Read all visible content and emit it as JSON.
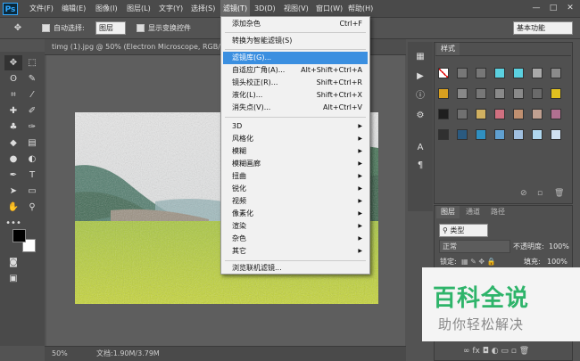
{
  "app": {
    "logo": "Ps"
  },
  "menubar": {
    "items": [
      "文件(F)",
      "编辑(E)",
      "图像(I)",
      "图层(L)",
      "文字(Y)",
      "选择(S)",
      "滤镜(T)",
      "3D(D)",
      "视图(V)",
      "窗口(W)",
      "帮助(H)"
    ],
    "active": "滤镜(T)"
  },
  "window_controls": {
    "minimize": "—",
    "restore": "□",
    "close": "✕"
  },
  "options_bar": {
    "auto_select_label": "自动选择:",
    "auto_select_value": "图层",
    "show_transform_label": "显示变换控件",
    "workspace_value": "基本功能"
  },
  "document": {
    "tab_title": "timg (1).jpg @ 50% (Electron Microscope, RGB/8#) *",
    "zoom": "50%",
    "doc_info": "文档:1.90M/3.79M"
  },
  "filter_menu": {
    "top_items": [
      {
        "label": "添加杂色",
        "shortcut": "Ctrl+F"
      },
      {
        "label": "转换为智能滤镜(S)",
        "shortcut": ""
      }
    ],
    "mid_items": [
      {
        "label": "滤镜库(G)...",
        "shortcut": "",
        "highlighted": true
      },
      {
        "label": "自适应广角(A)...",
        "shortcut": "Alt+Shift+Ctrl+A"
      },
      {
        "label": "镜头校正(R)...",
        "shortcut": "Shift+Ctrl+R"
      },
      {
        "label": "液化(L)...",
        "shortcut": "Shift+Ctrl+X"
      },
      {
        "label": "消失点(V)...",
        "shortcut": "Alt+Ctrl+V"
      }
    ],
    "sub_items": [
      "3D",
      "风格化",
      "模糊",
      "模糊画廊",
      "扭曲",
      "锐化",
      "视频",
      "像素化",
      "渲染",
      "杂色",
      "其它"
    ],
    "bottom_items": [
      "浏览联机滤镜..."
    ]
  },
  "styles_panel": {
    "tab": "样式"
  },
  "layers_panel": {
    "tabs": [
      "图层",
      "通道",
      "路径"
    ],
    "kind_filter": "类型",
    "blend_mode": "正常",
    "opacity_label": "不透明度:",
    "opacity_value": "100%",
    "lock_label": "锁定:",
    "fill_label": "填充:",
    "fill_value": "100%"
  },
  "watermark": {
    "title": "百科全说",
    "subtitle": "助你轻松解决"
  },
  "colors": {
    "menu_highlight": "#3b8fe0",
    "watermark_green": "#2eb46a"
  }
}
